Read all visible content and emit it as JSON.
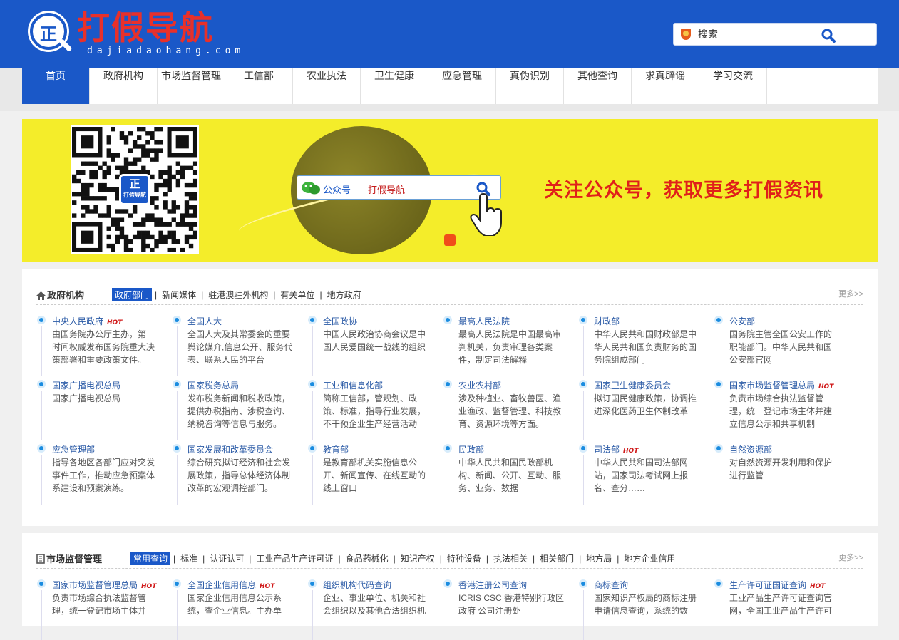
{
  "logo": {
    "mark": "正",
    "title": "打假导航",
    "pinyin": "dajiadaohang.com"
  },
  "search": {
    "placeholder": "搜索"
  },
  "nav": [
    "首页",
    "政府机构",
    "市场监督管理",
    "工信部",
    "农业执法",
    "卫生健康",
    "应急管理",
    "真伪识别",
    "其他查询",
    "求真辟谣",
    "学习交流"
  ],
  "banner": {
    "qr_logo_mark": "正",
    "qr_logo_text": "打假导航",
    "wx_label": "公众号",
    "wx_value": "打假导航",
    "slogan": "关注公众号，获取更多打假资讯"
  },
  "panel1": {
    "title": "政府机构",
    "tabs": [
      "政府部门",
      "新闻媒体",
      "驻港澳驻外机构",
      "有关单位",
      "地方政府"
    ],
    "more": "更多>>",
    "hot_label": "HOT",
    "items": [
      {
        "title": "中央人民政府",
        "hot": true,
        "desc": "由国务院办公厅主办，第一时间权威发布国务院重大决策部署和重要政策文件。"
      },
      {
        "title": "全国人大",
        "hot": false,
        "desc": "全国人大及其常委会的重要舆论媒介,信息公开、服务代表、联系人民的平台"
      },
      {
        "title": "全国政协",
        "hot": false,
        "desc": "中国人民政治协商会议是中国人民爱国统一战线的组织"
      },
      {
        "title": "最高人民法院",
        "hot": false,
        "desc": "最高人民法院是中国最高审判机关，负责审理各类案件，制定司法解释"
      },
      {
        "title": "财政部",
        "hot": false,
        "desc": "中华人民共和国财政部是中华人民共和国负责财务的国务院组成部门"
      },
      {
        "title": "公安部",
        "hot": false,
        "desc": "国务院主管全国公安工作的职能部门。中华人民共和国公安部官网"
      },
      {
        "title": "国家广播电视总局",
        "hot": false,
        "desc": "国家广播电视总局"
      },
      {
        "title": "国家税务总局",
        "hot": false,
        "desc": "发布税务新闻和税收政策，提供办税指南、涉税查询、纳税咨询等信息与服务。"
      },
      {
        "title": "工业和信息化部",
        "hot": false,
        "desc": "简称工信部，管规划、政策、标准，指导行业发展，不干预企业生产经营活动"
      },
      {
        "title": "农业农村部",
        "hot": false,
        "desc": "涉及种植业、畜牧兽医、渔业渔政、监督管理、科技教育、资源环境等方面。"
      },
      {
        "title": "国家卫生健康委员会",
        "hot": false,
        "desc": "拟订国民健康政策，协调推进深化医药卫生体制改革"
      },
      {
        "title": "国家市场监督管理总局",
        "hot": true,
        "desc": "负责市场综合执法监督管理，统一登记市场主体并建立信息公示和共享机制"
      },
      {
        "title": "应急管理部",
        "hot": false,
        "desc": "指导各地区各部门应对突发事件工作，推动应急预案体系建设和预案演练。"
      },
      {
        "title": "国家发展和改革委员会",
        "hot": false,
        "desc": "综合研究拟订经济和社会发展政策，指导总体经济体制改革的宏观调控部门。"
      },
      {
        "title": "教育部",
        "hot": false,
        "desc": "是教育部机关实施信息公开、新闻宣传、在线互动的线上窗口"
      },
      {
        "title": "民政部",
        "hot": false,
        "desc": "中华人民共和国民政部机构、新闻、公开、互动、服务、业务、数据"
      },
      {
        "title": "司法部",
        "hot": true,
        "desc": "中华人民共和国司法部网站，国家司法考试网上报名、查分……"
      },
      {
        "title": "自然资源部",
        "hot": false,
        "desc": "对自然资源开发利用和保护进行监管"
      }
    ]
  },
  "panel2": {
    "title": "市场监督管理",
    "tabs": [
      "常用查询",
      "标准",
      "认证认可",
      "工业产品生产许可证",
      "食品药械化",
      "知识产权",
      "特种设备",
      "执法相关",
      "相关部门",
      "地方局",
      "地方企业信用"
    ],
    "more": "更多>>",
    "items": [
      {
        "title": "国家市场监督管理总局",
        "hot": true,
        "desc": "负责市场综合执法监督管理，统一登记市场主体并"
      },
      {
        "title": "全国企业信用信息",
        "hot": true,
        "desc": "国家企业信用信息公示系统，查企业信息。主办单"
      },
      {
        "title": "组织机构代码查询",
        "hot": false,
        "desc": "企业、事业单位、机关和社会组织以及其他合法组织机"
      },
      {
        "title": "香港注册公司查询",
        "hot": false,
        "desc": "ICRIS CSC 香港特别行政区政府 公司注册处"
      },
      {
        "title": "商标查询",
        "hot": false,
        "desc": "国家知识产权局的商标注册申请信息查询，系统的数"
      },
      {
        "title": "生产许可证国证查询",
        "hot": true,
        "desc": "工业产品生产许可证查询官网，全国工业产品生产许可"
      }
    ]
  }
}
